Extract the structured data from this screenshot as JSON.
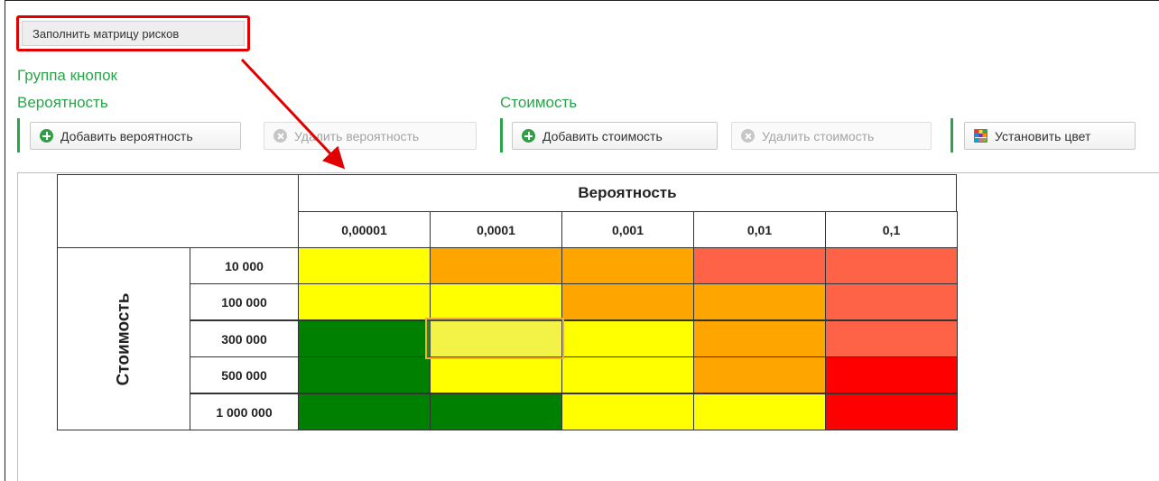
{
  "toolbar": {
    "fill_matrix_label": "Заполнить матрицу рисков",
    "group_label": "Группа кнопок",
    "probability_label": "Вероятность",
    "cost_label": "Стоимость",
    "add_probability": "Добавить вероятность",
    "remove_probability": "Удалить вероятность",
    "add_cost": "Добавить стоимость",
    "remove_cost": "Удалить стоимость",
    "set_color": "Установить цвет"
  },
  "matrix": {
    "col_header": "Вероятность",
    "row_header": "Стоимость",
    "probabilities": [
      "0,00001",
      "0,0001",
      "0,001",
      "0,01",
      "0,1"
    ],
    "costs": [
      "10 000",
      "100 000",
      "300 000",
      "500 000",
      "1 000 000"
    ],
    "selected_cell": {
      "row": 2,
      "col": 1
    },
    "colors": {
      "yellow": "#ffff00",
      "orange": "#ffa500",
      "tomato": "#ff6347",
      "red": "#ff0000",
      "green": "#008000",
      "selected": "#f2f22e"
    },
    "cells": [
      [
        "yellow",
        "orange",
        "orange",
        "tomato",
        "tomato"
      ],
      [
        "yellow",
        "yellow",
        "orange",
        "orange",
        "tomato"
      ],
      [
        "green",
        "selected",
        "yellow",
        "orange",
        "tomato"
      ],
      [
        "green",
        "yellow",
        "yellow",
        "orange",
        "red"
      ],
      [
        "green",
        "green",
        "yellow",
        "yellow",
        "red"
      ]
    ]
  },
  "annotation": {
    "highlight_color": "#e00000"
  }
}
